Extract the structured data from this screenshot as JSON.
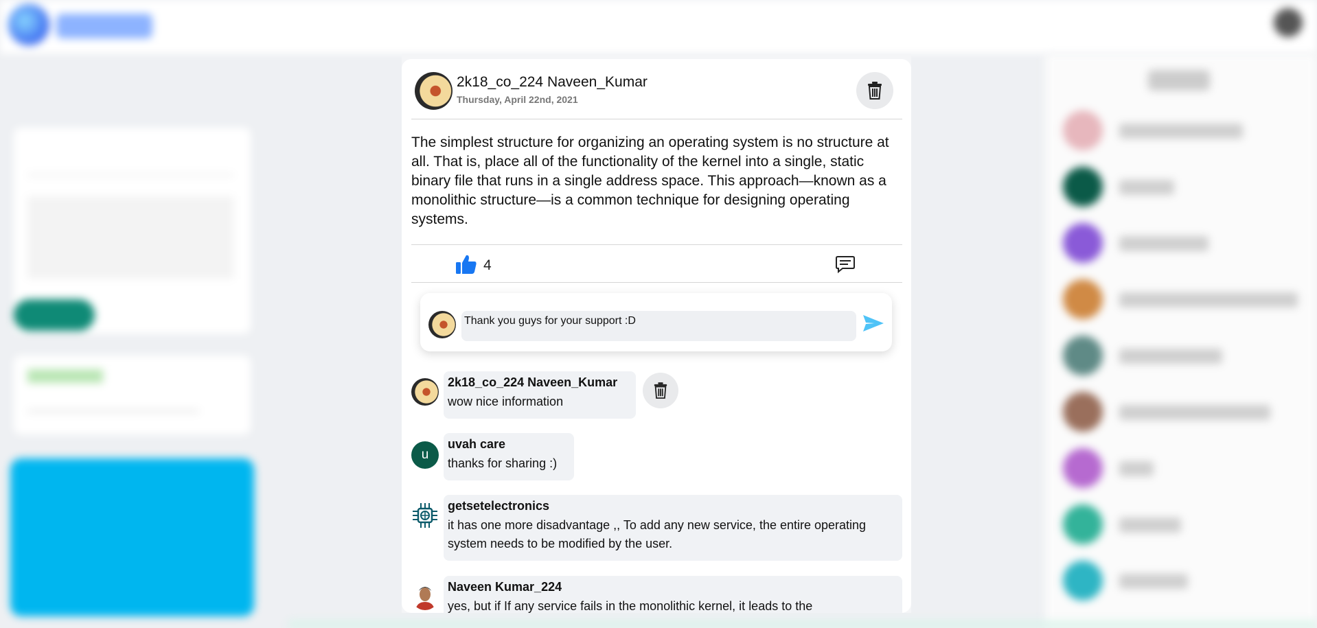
{
  "post": {
    "author": "2k18_co_224 Naveen_Kumar",
    "date": "Thursday, April 22nd, 2021",
    "body": "The simplest structure for organizing an operating system is no structure at all. That is, place all of the functionality of the kernel into a single, static binary file that runs in a single address space. This approach—known as a monolithic structure—is a common technique for designing operating systems.",
    "like_count": "4",
    "avatar_icon": "user-avatar-icon",
    "delete_icon": "trash-icon"
  },
  "compose": {
    "value": "Thank you guys for your support :D",
    "send_icon": "send-icon"
  },
  "comments": [
    {
      "name": "2k18_co_224 Naveen_Kumar",
      "text": "wow nice information",
      "avatar_letter": ""
    },
    {
      "name": "uvah care",
      "text": "thanks for sharing :)",
      "avatar_letter": "u"
    },
    {
      "name": "getsetelectronics",
      "text": "it has one more disadvantage ,, To add any new service, the entire operating system needs to be modified by the user.",
      "avatar_letter": ""
    },
    {
      "name": "Naveen Kumar_224",
      "text": "yes, but if If any service fails in the monolithic kernel, it leads to the",
      "avatar_letter": ""
    }
  ],
  "colors": {
    "like_blue": "#1877f2",
    "send_blue": "#4fc3f7",
    "uvah_avatar": "#0b5a48",
    "left_highlight": "#00b6ef",
    "left_button": "#0f8a76"
  }
}
